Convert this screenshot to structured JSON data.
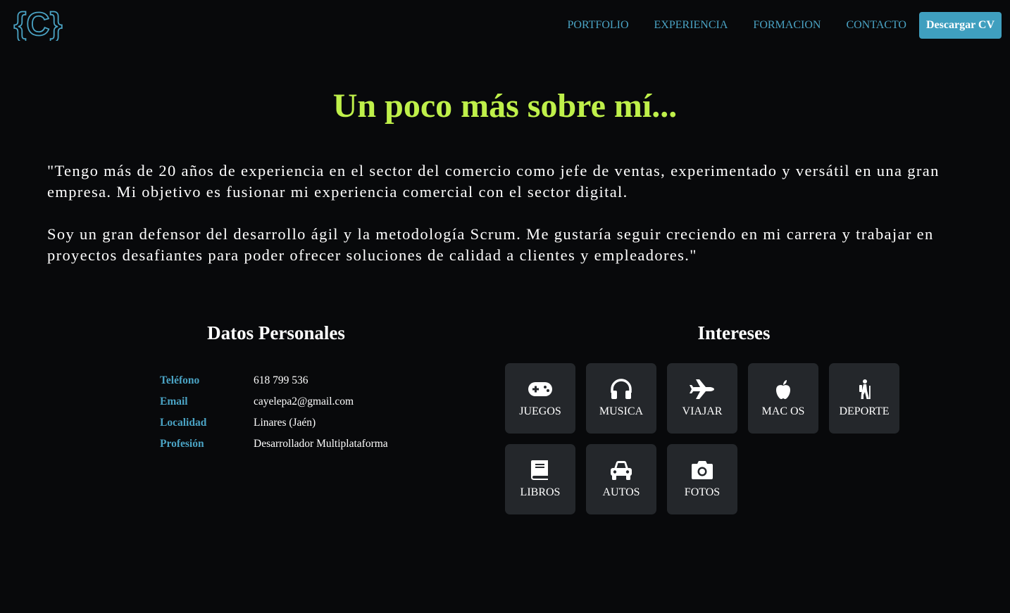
{
  "nav": {
    "items": [
      {
        "label": "PORTFOLIO"
      },
      {
        "label": "EXPERIENCIA"
      },
      {
        "label": "FORMACION"
      },
      {
        "label": "CONTACTO"
      }
    ],
    "cv_button": "Descargar CV"
  },
  "logo": {
    "text": "{C}"
  },
  "about": {
    "title": "Un poco más sobre mí...",
    "paragraph1": "\"Tengo más de 20 años de experiencia en el sector del comercio como jefe de ventas, experimentado y versátil en una gran empresa. Mi objetivo es fusionar mi experiencia comercial con el sector digital.",
    "paragraph2": "Soy un gran defensor del desarrollo ágil y la metodología Scrum. Me gustaría seguir creciendo en mi carrera y trabajar en proyectos desafiantes para poder ofrecer soluciones de calidad a clientes y empleadores.\""
  },
  "personal": {
    "title": "Datos Personales",
    "rows": [
      {
        "label": "Teléfono",
        "value": "618 799 536"
      },
      {
        "label": "Email",
        "value": "cayelepa2@gmail.com"
      },
      {
        "label": "Localidad",
        "value": "Linares (Jaén)"
      },
      {
        "label": "Profesión",
        "value": "Desarrollador Multiplataforma"
      }
    ]
  },
  "interests": {
    "title": "Intereses",
    "items": [
      {
        "label": "JUEGOS",
        "icon": "gamepad-icon"
      },
      {
        "label": "MUSICA",
        "icon": "headphones-icon"
      },
      {
        "label": "VIAJAR",
        "icon": "plane-icon"
      },
      {
        "label": "MAC OS",
        "icon": "apple-icon"
      },
      {
        "label": "DEPORTE",
        "icon": "hiking-icon"
      },
      {
        "label": "LIBROS",
        "icon": "book-icon"
      },
      {
        "label": "AUTOS",
        "icon": "car-icon"
      },
      {
        "label": "FOTOS",
        "icon": "camera-icon"
      }
    ]
  },
  "colors": {
    "background": "#08090b",
    "accent_blue": "#4aa3c4",
    "title_green": "#bff04a",
    "card_bg": "#24272b"
  }
}
